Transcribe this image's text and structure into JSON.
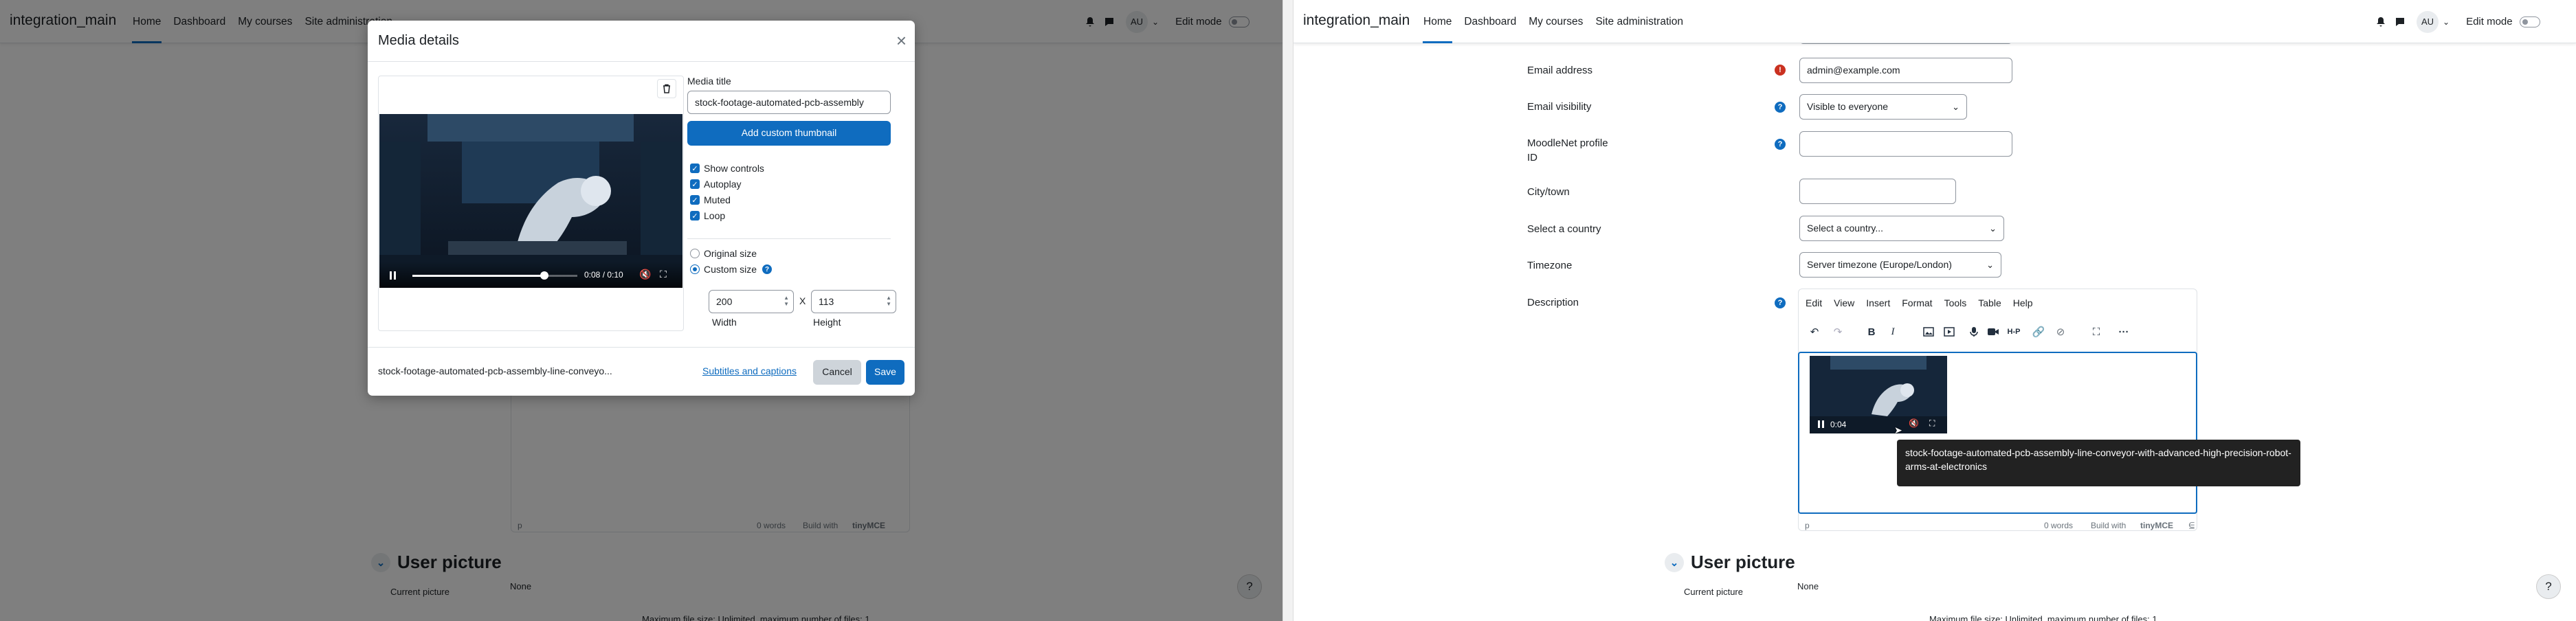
{
  "nav": {
    "brand": "integration_main",
    "links": [
      "Home",
      "Dashboard",
      "My courses",
      "Site administration"
    ],
    "avatar": "AU",
    "edit_mode": "Edit mode"
  },
  "modal": {
    "title": "Media details",
    "media_title_label": "Media title",
    "media_title_value": "stock-footage-automated-pcb-assembly",
    "add_thumbnail": "Add custom thumbnail",
    "options": [
      "Show controls",
      "Autoplay",
      "Muted",
      "Loop"
    ],
    "size_original": "Original size",
    "size_custom": "Custom size",
    "width_value": "200",
    "height_value": "113",
    "x_sep": "X",
    "width_label": "Width",
    "height_label": "Height",
    "video_time": "0:08 / 0:10",
    "video_progress": 0.8,
    "footer_filename": "stock-footage-automated-pcb-assembly-line-conveyo...",
    "subtitles_link": "Subtitles and captions",
    "cancel": "Cancel",
    "save": "Save"
  },
  "left_bg": {
    "statusbar_path": "p",
    "word_count": "0 words",
    "build_with": "Build with",
    "tinymce": "tinyMCE",
    "section": "User picture",
    "current_picture_label": "Current picture",
    "current_picture_value": "None",
    "max_file": "Maximum file size: Unlimited, maximum number of files: 1",
    "help_button": "?"
  },
  "form": {
    "email_label": "Email address",
    "email_value": "admin@example.com",
    "email_visibility_label": "Email visibility",
    "email_visibility_value": "Visible to everyone",
    "moodlenet_label_1": "MoodleNet profile",
    "moodlenet_label_2": "ID",
    "moodlenet_value": "",
    "city_label": "City/town",
    "city_value": "",
    "country_label": "Select a country",
    "country_value": "Select a country...",
    "timezone_label": "Timezone",
    "timezone_value": "Server timezone (Europe/London)",
    "description_label": "Description"
  },
  "editor": {
    "menu": [
      "Edit",
      "View",
      "Insert",
      "Format",
      "Tools",
      "Table",
      "Help"
    ],
    "video_time": "0:04",
    "tooltip": "stock-footage-automated-pcb-assembly-line-conveyor-with-advanced-high-precision-robot-arms-at-electronics",
    "statusbar_path": "p",
    "word_count": "0 words",
    "build_with": "Build with",
    "tinymce": "tinyMCE"
  },
  "right_bottom": {
    "section": "User picture",
    "current_picture_label": "Current picture",
    "current_picture_value": "None",
    "max_file": "Maximum file size: Unlimited, maximum number of files: 1",
    "help_button": "?"
  },
  "colors": {
    "primary": "#0f6cbf",
    "danger": "#ca3120",
    "overlay": "rgba(0,0,0,0.5)"
  }
}
